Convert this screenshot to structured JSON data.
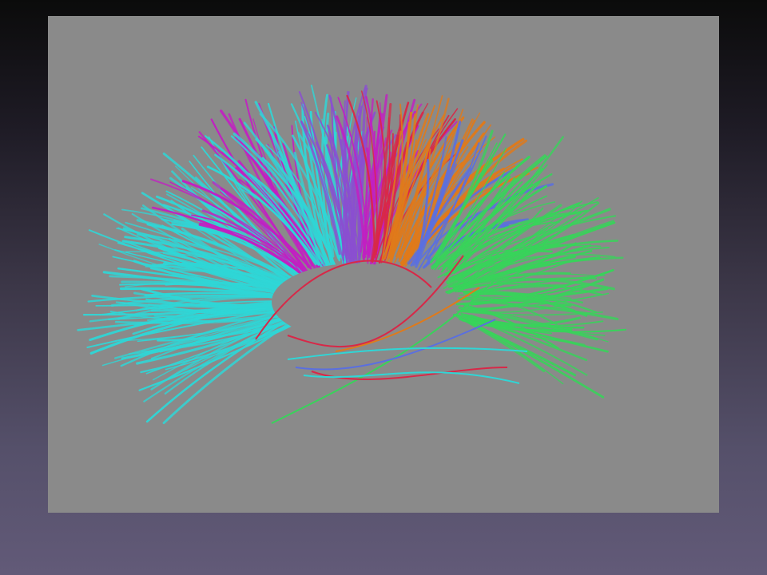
{
  "slide": {
    "background_top": "#0b0b0b",
    "background_bottom": "#625a78"
  },
  "figure": {
    "panel_color": "#8a8a8a",
    "subject": "tractography-fiber-bundles",
    "bundle_colors": {
      "cyan": "#2fd6d6",
      "magenta": "#c21fc2",
      "purple": "#8a4fd0",
      "red": "#d82848",
      "orange": "#e07a1a",
      "blue": "#5a6fe0",
      "green": "#38d35a"
    }
  }
}
